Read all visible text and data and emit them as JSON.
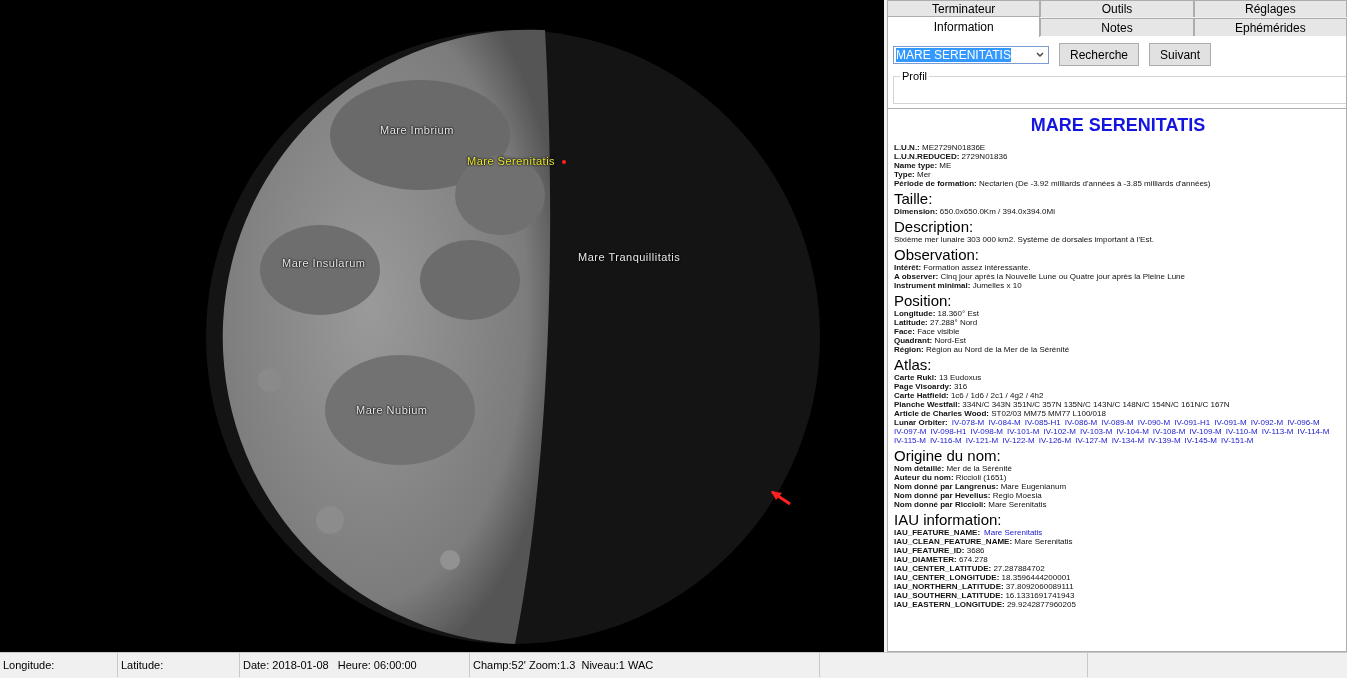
{
  "moon_view": {
    "labels": [
      {
        "text": "Mare Imbrium",
        "selected": false
      },
      {
        "text": "Mare Serenitatis",
        "selected": true
      },
      {
        "text": "Mare Insularum",
        "selected": false
      },
      {
        "text": "Mare Tranquillitatis",
        "selected": false
      },
      {
        "text": "Mare Nubium",
        "selected": false
      }
    ]
  },
  "tabs": {
    "back_row": [
      {
        "label": "Terminateur",
        "selected": false
      },
      {
        "label": "Outils",
        "selected": false
      },
      {
        "label": "Réglages",
        "selected": false
      }
    ],
    "front_row": [
      {
        "label": "Information",
        "selected": true
      },
      {
        "label": "Notes",
        "selected": false
      },
      {
        "label": "Ephémérides",
        "selected": false
      }
    ]
  },
  "search": {
    "value": "MARE SERENITATIS",
    "buttons": [
      "Recherche",
      "Suivant"
    ]
  },
  "profile": {
    "title": "Profil"
  },
  "info": {
    "title": "MARE SERENITATIS",
    "header_lines": [
      {
        "kind": "text",
        "label": "L.U.N.:",
        "value": "ME2729N01836E"
      },
      {
        "kind": "text",
        "label": "L.U.N.REDUCED:",
        "value": "2729N01836"
      },
      {
        "kind": "text",
        "label": "Name type:",
        "value": "ME"
      },
      {
        "kind": "text",
        "label": "Type:",
        "value": "Mer"
      },
      {
        "kind": "text",
        "label": "Période de formation:",
        "value": "Nectarien (De -3.92 milliards d'années à -3.85 milliards d'années)"
      }
    ],
    "sections": [
      {
        "heading": "Taille:",
        "lines": [
          {
            "kind": "text",
            "label": "Dimension:",
            "value": "650.0x650.0Km / 394.0x394.0Mi"
          }
        ]
      },
      {
        "heading": "Description:",
        "lines": [
          {
            "kind": "plain",
            "value": "Sixième mer lunaire 303 000 km2. Système de dorsales important à l'Est."
          }
        ]
      },
      {
        "heading": "Observation:",
        "lines": [
          {
            "kind": "text",
            "label": "Intérêt:",
            "value": "Formation assez intéressante."
          },
          {
            "kind": "text",
            "label": "A observer:",
            "value": "Cinq jour après la Nouvelle Lune ou Quatre jour après la Pleine Lune"
          },
          {
            "kind": "text",
            "label": "Instrument minimal:",
            "value": "Jumelles x 10"
          }
        ]
      },
      {
        "heading": "Position:",
        "lines": [
          {
            "kind": "text",
            "label": "Longitude:",
            "value": "18.360° Est"
          },
          {
            "kind": "text",
            "label": "Latitude:",
            "value": "27.288° Nord"
          },
          {
            "kind": "text",
            "label": "Face:",
            "value": "Face visible"
          },
          {
            "kind": "text",
            "label": "Quadrant:",
            "value": "Nord-Est"
          },
          {
            "kind": "text",
            "label": "Région:",
            "value": "Région au Nord de la Mer de la Sérénité"
          }
        ]
      },
      {
        "heading": "Atlas:",
        "lines": [
          {
            "kind": "text",
            "label": "Carte Rukl:",
            "value": "13 Eudoxus"
          },
          {
            "kind": "text",
            "label": "Page Visoardy:",
            "value": "316"
          },
          {
            "kind": "text",
            "label": "Carte Hatfield:",
            "value": "1c6 / 1d6 / 2c1 / 4g2 / 4h2"
          },
          {
            "kind": "text",
            "label": "Planche Westfall:",
            "value": "334N/C 343N 351N/C 357N 135N/C 143N/C 148N/C 154N/C 161N/C 167N"
          },
          {
            "kind": "text",
            "label": "Article de Charles Wood:",
            "value": "ST02/03 MM75 MM77 L100/018"
          },
          {
            "kind": "links",
            "label": "Lunar Orbiter:",
            "links": [
              "IV-078-M",
              "IV-084-M",
              "IV-085-H1",
              "IV-086-M",
              "IV-089-M",
              "IV-090-M",
              "IV-091-H1",
              "IV-091-M",
              "IV-092-M",
              "IV-096-M",
              "IV-097-M",
              "IV-098-H1",
              "IV-098-M",
              "IV-101-M",
              "IV-102-M",
              "IV-103-M",
              "IV-104-M",
              "IV-108-M",
              "IV-109-M",
              "IV-110-M",
              "IV-113-M",
              "IV-114-M",
              "IV-115-M",
              "IV-116-M",
              "IV-121-M",
              "IV-122-M",
              "IV-126-M",
              "IV-127-M",
              "IV-134-M",
              "IV-139-M",
              "IV-145-M",
              "IV-151-M"
            ]
          }
        ]
      },
      {
        "heading": "Origine du nom:",
        "lines": [
          {
            "kind": "text",
            "label": "Nom détaillé:",
            "value": "Mer de la Sérénité"
          },
          {
            "kind": "text",
            "label": "Auteur du nom:",
            "value": "Riccioli (1651)"
          },
          {
            "kind": "text",
            "label": "Nom donné par Langrenus:",
            "value": "Mare Eugenianum"
          },
          {
            "kind": "text",
            "label": "Nom donné par Hevelius:",
            "value": "Regio Moesia"
          },
          {
            "kind": "text",
            "label": "Nom donné par Riccioli:",
            "value": "Mare Serenitatis"
          }
        ]
      },
      {
        "heading": "IAU information:",
        "lines": [
          {
            "kind": "links",
            "label": "IAU_FEATURE_NAME:",
            "links": [
              "Mare Serenitatis"
            ]
          },
          {
            "kind": "text",
            "label": "IAU_CLEAN_FEATURE_NAME:",
            "value": "Mare Serenitatis"
          },
          {
            "kind": "text",
            "label": "IAU_FEATURE_ID:",
            "value": "3686"
          },
          {
            "kind": "text",
            "label": "IAU_DIAMETER:",
            "value": "674.278"
          },
          {
            "kind": "text",
            "label": "IAU_CENTER_LATITUDE:",
            "value": "27.287884702"
          },
          {
            "kind": "text",
            "label": "IAU_CENTER_LONGITUDE:",
            "value": "18.3596444200001"
          },
          {
            "kind": "text",
            "label": "IAU_NORTHERN_LATITUDE:",
            "value": "37.8092060089111"
          },
          {
            "kind": "text",
            "label": "IAU_SOUTHERN_LATITUDE:",
            "value": "16.1331691741943"
          },
          {
            "kind": "text",
            "label": "IAU_EASTERN_LONGITUDE:",
            "value": "29.9242877960205"
          }
        ]
      }
    ]
  },
  "status_bar": [
    "Longitude:",
    "Latitude:",
    "Date: 2018-01-08   Heure: 06:00:00",
    "Champ:52' Zoom:1.3  Niveau:1 WAC"
  ]
}
